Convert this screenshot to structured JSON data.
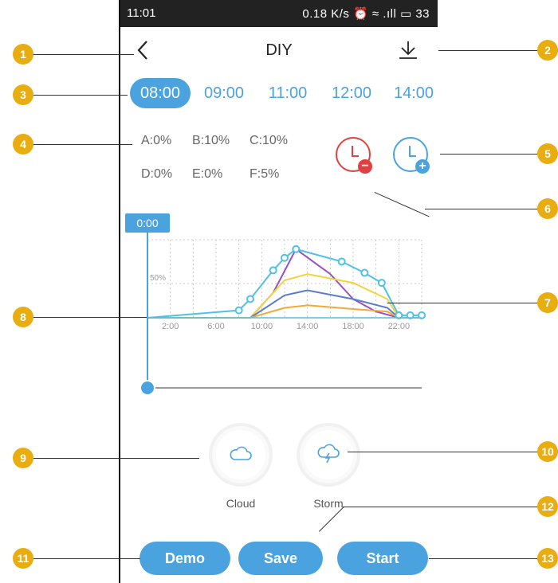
{
  "status": {
    "time": "11:01",
    "right": "0.18 K/s ⏰ ≈ .ıll ▭ 33"
  },
  "header": {
    "title": "DIY"
  },
  "time_tabs": [
    "08:00",
    "09:00",
    "11:00",
    "12:00",
    "14:00"
  ],
  "active_tab": "08:00",
  "channels": {
    "row1": [
      "A:0%",
      "B:10%",
      "C:10%"
    ],
    "row2": [
      "D:0%",
      "E:0%",
      "F:5%"
    ]
  },
  "clock_remove": {
    "badge": "−",
    "color": "#e14040"
  },
  "clock_add": {
    "badge": "+",
    "color": "#4aa3df"
  },
  "timeline": {
    "current_label": "0:00",
    "slider_value": 0
  },
  "chart_data": {
    "type": "line",
    "x_ticks": [
      "2:00",
      "6:00",
      "10:00",
      "14:00",
      "18:00",
      "22:00"
    ],
    "y_tick": "50%",
    "x_range": [
      0,
      24
    ],
    "y_range": [
      0,
      100
    ],
    "series": [
      {
        "color": "#4ec1e6",
        "points": [
          [
            0,
            0
          ],
          [
            8,
            6
          ],
          [
            9,
            15
          ],
          [
            11,
            38
          ],
          [
            12,
            48
          ],
          [
            13,
            55
          ],
          [
            17,
            45
          ],
          [
            19,
            36
          ],
          [
            20.5,
            28
          ],
          [
            22,
            2
          ],
          [
            23,
            2
          ],
          [
            24,
            2
          ]
        ]
      },
      {
        "color": "#9b4fc4",
        "points": [
          [
            0,
            0
          ],
          [
            9,
            0
          ],
          [
            11,
            20
          ],
          [
            13,
            55
          ],
          [
            16,
            35
          ],
          [
            18,
            15
          ],
          [
            20,
            5
          ],
          [
            22,
            0
          ],
          [
            24,
            0
          ]
        ]
      },
      {
        "color": "#f2d43a",
        "points": [
          [
            0,
            0
          ],
          [
            9,
            0
          ],
          [
            12,
            30
          ],
          [
            14,
            35
          ],
          [
            18,
            28
          ],
          [
            21,
            15
          ],
          [
            22,
            0
          ],
          [
            24,
            0
          ]
        ]
      },
      {
        "color": "#5b7bd0",
        "points": [
          [
            0,
            0
          ],
          [
            9,
            0
          ],
          [
            12,
            18
          ],
          [
            14,
            22
          ],
          [
            18,
            15
          ],
          [
            21,
            8
          ],
          [
            22,
            0
          ],
          [
            24,
            0
          ]
        ]
      },
      {
        "color": "#f2a93a",
        "points": [
          [
            0,
            0
          ],
          [
            9,
            0
          ],
          [
            12,
            8
          ],
          [
            14,
            10
          ],
          [
            18,
            7
          ],
          [
            21,
            5
          ],
          [
            22,
            0
          ],
          [
            24,
            0
          ]
        ]
      }
    ]
  },
  "effects": [
    {
      "label": "Cloud",
      "icon": "cloud-icon"
    },
    {
      "label": "Storm",
      "icon": "storm-icon"
    }
  ],
  "buttons": {
    "demo": "Demo",
    "save": "Save",
    "start": "Start"
  },
  "callouts": [
    "1",
    "2",
    "3",
    "4",
    "5",
    "6",
    "7",
    "8",
    "9",
    "10",
    "11",
    "12",
    "13"
  ],
  "colors": {
    "accent": "#4aa3df",
    "callout": "#e8ad10",
    "remove": "#e14040"
  }
}
